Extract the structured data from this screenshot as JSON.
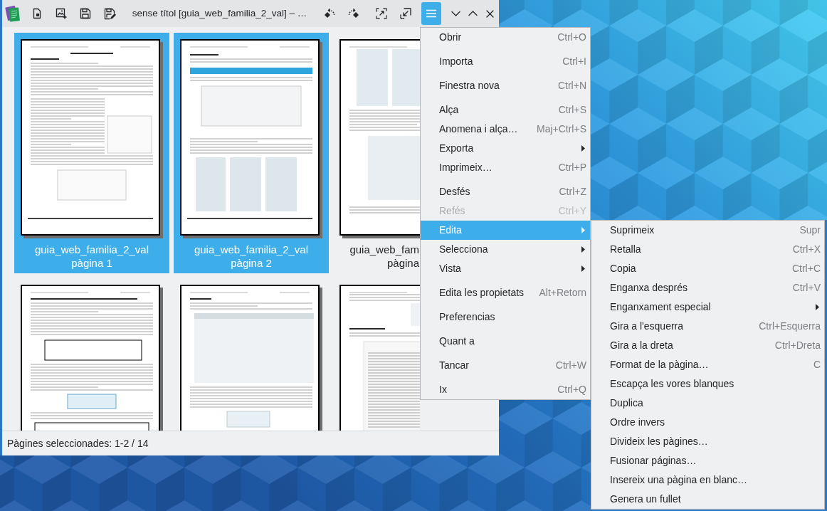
{
  "window": {
    "title": "sense títol [guia_web_familia_2_val] – …"
  },
  "header_bar": {
    "menu_button": {
      "pressed": true
    }
  },
  "pages": [
    {
      "file": "guia_web_familia_2_val",
      "page": "pàgina 1",
      "selected": true
    },
    {
      "file": "guia_web_familia_2_val",
      "page": "pàgina 2",
      "selected": true
    },
    {
      "file": "guia_web_fam",
      "page": "pàgina",
      "selected": false
    },
    {
      "selected": false
    },
    {
      "selected": false
    },
    {
      "selected": false
    }
  ],
  "status_bar": {
    "text": "Pàgines seleccionades: 1-2 / 14"
  },
  "menu": {
    "sections": [
      {
        "items": [
          {
            "label": "Obrir",
            "shortcut": "Ctrl+O",
            "submenu": false,
            "disabled": false,
            "selected": false
          }
        ]
      },
      {
        "items": [
          {
            "label": "Importa",
            "shortcut": "Ctrl+I",
            "submenu": false,
            "disabled": false,
            "selected": false
          }
        ]
      },
      {
        "items": [
          {
            "label": "Finestra nova",
            "shortcut": "Ctrl+N",
            "submenu": false,
            "disabled": false,
            "selected": false
          }
        ]
      },
      {
        "items": [
          {
            "label": "Alça",
            "shortcut": "Ctrl+S",
            "submenu": false,
            "disabled": false,
            "selected": false
          },
          {
            "label": "Anomena i alça…",
            "shortcut": "Maj+Ctrl+S",
            "submenu": false,
            "disabled": false,
            "selected": false
          },
          {
            "label": "Exporta",
            "submenu": true,
            "disabled": false,
            "selected": false
          },
          {
            "label": "Imprimeix…",
            "shortcut": "Ctrl+P",
            "submenu": false,
            "disabled": false,
            "selected": false
          }
        ]
      },
      {
        "items": [
          {
            "label": "Desfés",
            "shortcut": "Ctrl+Z",
            "submenu": false,
            "disabled": false,
            "selected": false
          },
          {
            "label": "Refés",
            "shortcut": "Ctrl+Y",
            "submenu": false,
            "disabled": true,
            "selected": false
          },
          {
            "label": "Edita",
            "submenu": true,
            "disabled": false,
            "selected": true
          },
          {
            "label": "Selecciona",
            "submenu": true,
            "disabled": false,
            "selected": false
          },
          {
            "label": "Vista",
            "submenu": true,
            "disabled": false,
            "selected": false
          }
        ]
      },
      {
        "items": [
          {
            "label": "Edita les propietats",
            "shortcut": "Alt+Retorn",
            "submenu": false,
            "disabled": false,
            "selected": false
          }
        ]
      },
      {
        "items": [
          {
            "label": "Preferencias",
            "submenu": false,
            "disabled": false,
            "selected": false
          }
        ]
      },
      {
        "items": [
          {
            "label": "Quant a",
            "submenu": false,
            "disabled": false,
            "selected": false
          }
        ]
      },
      {
        "items": [
          {
            "label": "Tancar",
            "shortcut": "Ctrl+W",
            "submenu": false,
            "disabled": false,
            "selected": false
          }
        ]
      },
      {
        "items": [
          {
            "label": "Ix",
            "shortcut": "Ctrl+Q",
            "submenu": false,
            "disabled": false,
            "selected": false
          }
        ]
      }
    ]
  },
  "submenu": {
    "items": [
      {
        "label": "Suprimeix",
        "shortcut": "Supr",
        "submenu": false,
        "disabled": false,
        "selected": false
      },
      {
        "label": "Retalla",
        "shortcut": "Ctrl+X",
        "submenu": false,
        "disabled": false,
        "selected": false
      },
      {
        "label": "Copia",
        "shortcut": "Ctrl+C",
        "submenu": false,
        "disabled": false,
        "selected": false
      },
      {
        "label": "Enganxa després",
        "shortcut": "Ctrl+V",
        "submenu": false,
        "disabled": false,
        "selected": false
      },
      {
        "label": "Enganxament especial",
        "submenu": true,
        "disabled": false,
        "selected": false
      },
      {
        "label": "Gira a l'esquerra",
        "shortcut": "Ctrl+Esquerra",
        "submenu": false,
        "disabled": false,
        "selected": false
      },
      {
        "label": "Gira a la dreta",
        "shortcut": "Ctrl+Dreta",
        "submenu": false,
        "disabled": false,
        "selected": false
      },
      {
        "label": "Format de la pàgina…",
        "shortcut": "C",
        "submenu": false,
        "disabled": false,
        "selected": false
      },
      {
        "label": "Escapça les vores blanques",
        "submenu": false,
        "disabled": false,
        "selected": false
      },
      {
        "label": "Duplica",
        "submenu": false,
        "disabled": false,
        "selected": false
      },
      {
        "label": "Ordre invers",
        "submenu": false,
        "disabled": false,
        "selected": false
      },
      {
        "label": "Divideix les pàgines…",
        "submenu": false,
        "disabled": false,
        "selected": false
      },
      {
        "label": "Fusionar páginas…",
        "submenu": false,
        "disabled": false,
        "selected": false
      },
      {
        "label": "Insereix una pàgina en blanc…",
        "submenu": false,
        "disabled": false,
        "selected": false
      },
      {
        "label": "Genera un fullet",
        "submenu": false,
        "disabled": false,
        "selected": false
      }
    ]
  }
}
